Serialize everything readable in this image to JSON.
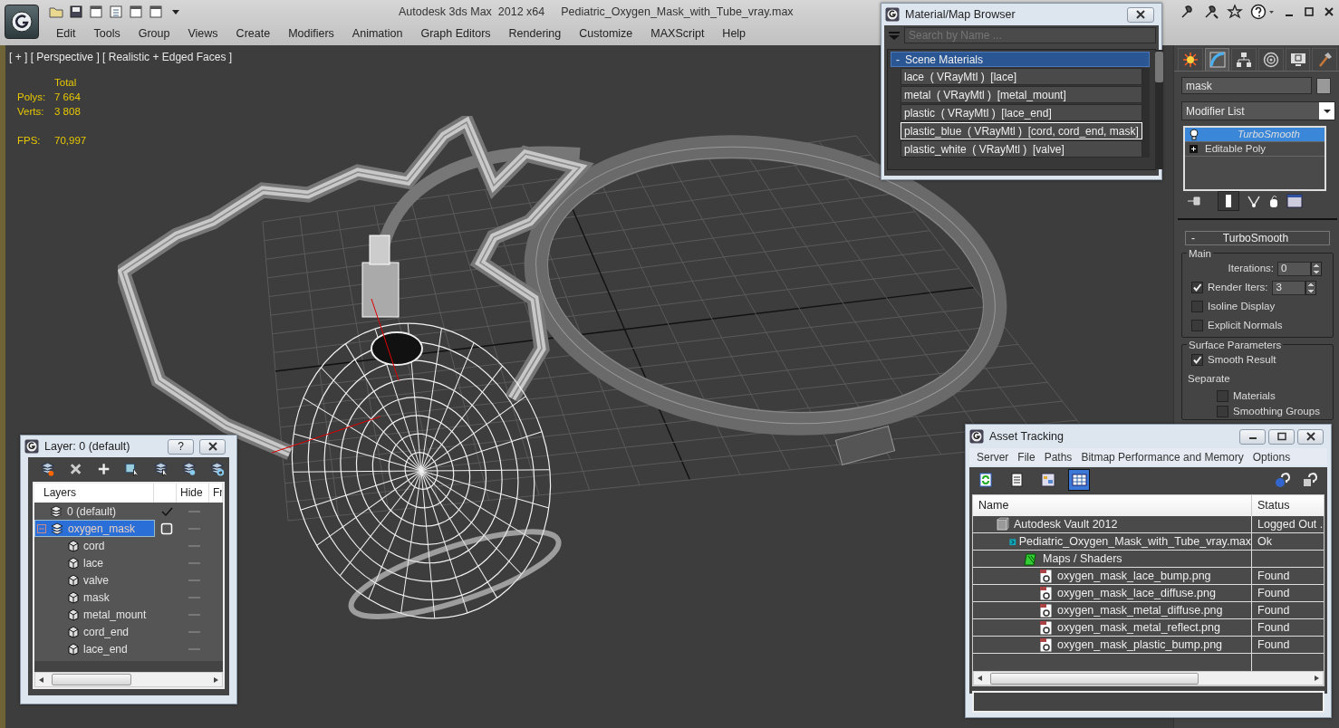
{
  "app": {
    "title": "Autodesk 3ds Max  2012 x64",
    "file": "Pediatric_Oxygen_Mask_with_Tube_vray.max"
  },
  "menu": [
    "Edit",
    "Tools",
    "Group",
    "Views",
    "Create",
    "Modifiers",
    "Animation",
    "Graph Editors",
    "Rendering",
    "Customize",
    "MAXScript",
    "Help"
  ],
  "viewport": {
    "label": "[ + ] [ Perspective ] [ Realistic + Edged Faces ]",
    "stats_header": "Total",
    "stats": [
      {
        "label": "Polys:",
        "value": "7 664"
      },
      {
        "label": "Verts:",
        "value": "3 808"
      }
    ],
    "fps_label": "FPS:",
    "fps": "70,997"
  },
  "material_browser": {
    "title": "Material/Map Browser",
    "search": {
      "placeholder": "Search by Name ..."
    },
    "group_toggle": "-",
    "group": "Scene Materials",
    "items": [
      {
        "text": "lace  ( VRayMtl )  [lace]",
        "selected": false
      },
      {
        "text": "metal  ( VRayMtl )  [metal_mount]",
        "selected": false
      },
      {
        "text": "plastic  ( VRayMtl )  [lace_end]",
        "selected": false
      },
      {
        "text": "plastic_blue  ( VRayMtl )  [cord, cord_end, mask]",
        "selected": true
      },
      {
        "text": "plastic_white  ( VRayMtl )  [valve]",
        "selected": false
      }
    ]
  },
  "command_panel": {
    "tabs": [
      {
        "selected": false
      },
      {
        "selected": true
      },
      {
        "selected": false
      },
      {
        "selected": false
      },
      {
        "selected": false
      },
      {
        "selected": false
      }
    ],
    "object_name": "mask",
    "modifier_list": "Modifier List",
    "stack": [
      {
        "label": "TurboSmooth",
        "kind": "modifier",
        "selected": true
      },
      {
        "label": "Editable Poly",
        "kind": "base",
        "selected": false
      }
    ],
    "rollout": {
      "toggle": "-",
      "title": "TurboSmooth",
      "groups": [
        {
          "title": "Main",
          "items": [
            {
              "kind": "spinner",
              "label": "Iterations:",
              "value": "0"
            },
            {
              "kind": "check_spinner",
              "label": "Render Iters:",
              "checked": true,
              "value": "3"
            },
            {
              "kind": "checkbox",
              "label": "Isoline Display",
              "checked": false
            },
            {
              "kind": "checkbox",
              "label": "Explicit Normals",
              "checked": false
            }
          ]
        },
        {
          "title": "Surface Parameters",
          "items": [
            {
              "kind": "checkbox",
              "label": "Smooth Result",
              "checked": true
            },
            {
              "kind": "heading",
              "label": "Separate",
              "children": [
                {
                  "kind": "checkbox",
                  "label": "Materials",
                  "checked": false
                },
                {
                  "kind": "checkbox",
                  "label": "Smoothing Groups",
                  "checked": false
                }
              ]
            }
          ]
        }
      ]
    }
  },
  "layer_window": {
    "title": "Layer: 0 (default)",
    "help": "?",
    "columns": [
      "Layers",
      "Hide",
      "Fr"
    ],
    "layers": [
      {
        "name": "0 (default)",
        "current": true,
        "selected": false
      },
      {
        "name": "oxygen_mask",
        "current": false,
        "selected": true,
        "expanded": true,
        "children": [
          {
            "name": "cord",
            "selected": false
          },
          {
            "name": "lace",
            "selected": false
          },
          {
            "name": "valve",
            "selected": false
          },
          {
            "name": "mask",
            "selected": false
          },
          {
            "name": "metal_mount",
            "selected": false
          },
          {
            "name": "cord_end",
            "selected": false
          },
          {
            "name": "lace_end",
            "selected": false
          }
        ]
      }
    ]
  },
  "asset_tracking": {
    "title": "Asset Tracking",
    "menu": [
      "Server",
      "File",
      "Paths",
      "Bitmap Performance and Memory",
      "Options"
    ],
    "toolbar": [
      {
        "selected": false
      },
      {
        "selected": false
      },
      {
        "selected": false
      },
      {
        "selected": true
      }
    ],
    "columns": [
      "Name",
      "Status"
    ],
    "rows": [
      {
        "name": "Autodesk Vault 2012",
        "status": "Logged Out .",
        "kind": "server",
        "children": [
          {
            "name": "Pediatric_Oxygen_Mask_with_Tube_vray.max",
            "status": "Ok",
            "kind": "scene",
            "children": [
              {
                "name": "Maps / Shaders",
                "kind": "folder",
                "children": [
                  {
                    "name": "oxygen_mask_lace_bump.png",
                    "status": "Found",
                    "kind": "bitmap"
                  },
                  {
                    "name": "oxygen_mask_lace_diffuse.png",
                    "status": "Found",
                    "kind": "bitmap"
                  },
                  {
                    "name": "oxygen_mask_metal_diffuse.png",
                    "status": "Found",
                    "kind": "bitmap"
                  },
                  {
                    "name": "oxygen_mask_metal_reflect.png",
                    "status": "Found",
                    "kind": "bitmap"
                  },
                  {
                    "name": "oxygen_mask_plastic_bump.png",
                    "status": "Found",
                    "kind": "bitmap"
                  }
                ]
              }
            ]
          }
        ]
      }
    ]
  }
}
